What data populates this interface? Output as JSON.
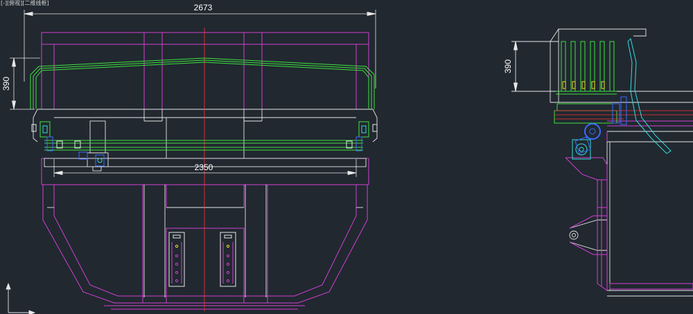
{
  "viewport": {
    "label": "[-][俯视][二维线框]"
  },
  "dimensions": {
    "overall_width": "2673",
    "inner_width": "2350",
    "height_left": "390",
    "height_right": "390"
  },
  "colors": {
    "background": "#212830",
    "magenta": "#d23fd2",
    "white": "#e8e8e8",
    "green": "#3ee23e",
    "red": "#ff3030",
    "cyan": "#33dddd",
    "blue": "#3a6cff",
    "yellow": "#e8e820"
  }
}
